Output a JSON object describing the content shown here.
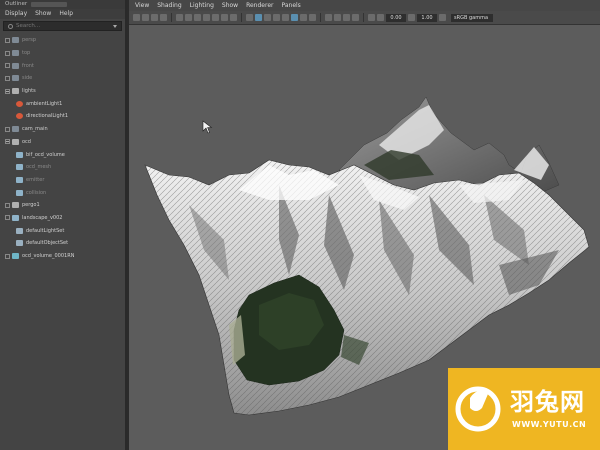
{
  "outliner": {
    "title": "Outliner",
    "menu": [
      "Display",
      "Show",
      "Help"
    ],
    "search_placeholder": "Search...",
    "items": [
      {
        "label": "persp",
        "icon": "camera-icon",
        "dim": true,
        "expander": "closed"
      },
      {
        "label": "top",
        "icon": "camera-icon",
        "dim": true,
        "expander": "closed"
      },
      {
        "label": "front",
        "icon": "camera-icon",
        "dim": true,
        "expander": "closed"
      },
      {
        "label": "side",
        "icon": "camera-icon",
        "dim": true,
        "expander": "closed"
      },
      {
        "label": "lights",
        "icon": "group-icon",
        "dim": false,
        "expander": "open"
      },
      {
        "label": "ambientLight1",
        "icon": "light-icon",
        "dim": false,
        "expander": "none"
      },
      {
        "label": "directionalLight1",
        "icon": "light-icon",
        "dim": false,
        "expander": "none"
      },
      {
        "label": "cam_main",
        "icon": "camera-icon",
        "dim": false,
        "expander": "closed"
      },
      {
        "label": "ocd",
        "icon": "group-icon",
        "dim": false,
        "expander": "open"
      },
      {
        "label": "bif_ocd_volume",
        "icon": "mesh-icon",
        "dim": false,
        "expander": "none"
      },
      {
        "label": "ocd_mesh",
        "icon": "mesh-icon",
        "dim": true,
        "expander": "none"
      },
      {
        "label": "emitter",
        "icon": "mesh-icon",
        "dim": true,
        "expander": "none"
      },
      {
        "label": "collision",
        "icon": "mesh-icon",
        "dim": true,
        "expander": "none"
      },
      {
        "label": "pergo1",
        "icon": "group-icon",
        "dim": false,
        "expander": "closed"
      },
      {
        "label": "landscape_v002",
        "icon": "mesh-icon",
        "dim": false,
        "expander": "closed"
      },
      {
        "label": "defaultLightSet",
        "icon": "set-icon",
        "dim": false,
        "expander": "none"
      },
      {
        "label": "defaultObjectSet",
        "icon": "set-icon",
        "dim": false,
        "expander": "none"
      },
      {
        "label": "ocd_volume_0001RN",
        "icon": "reference-icon",
        "dim": false,
        "expander": "closed"
      }
    ]
  },
  "viewport": {
    "menu": [
      "View",
      "Shading",
      "Lighting",
      "Show",
      "Renderer",
      "Panels"
    ],
    "exposure_value": "0.00",
    "gamma_value": "1.00",
    "color_space": "sRGB gamma"
  },
  "watermark": {
    "brand_cn": "羽兔网",
    "url": "WWW.YUTU.CN"
  },
  "colors": {
    "watermark_bg": "#efb622",
    "viewport_bg": "#5c5c5c",
    "outliner_bg": "#444444",
    "highlight": "#5a8fb0"
  }
}
